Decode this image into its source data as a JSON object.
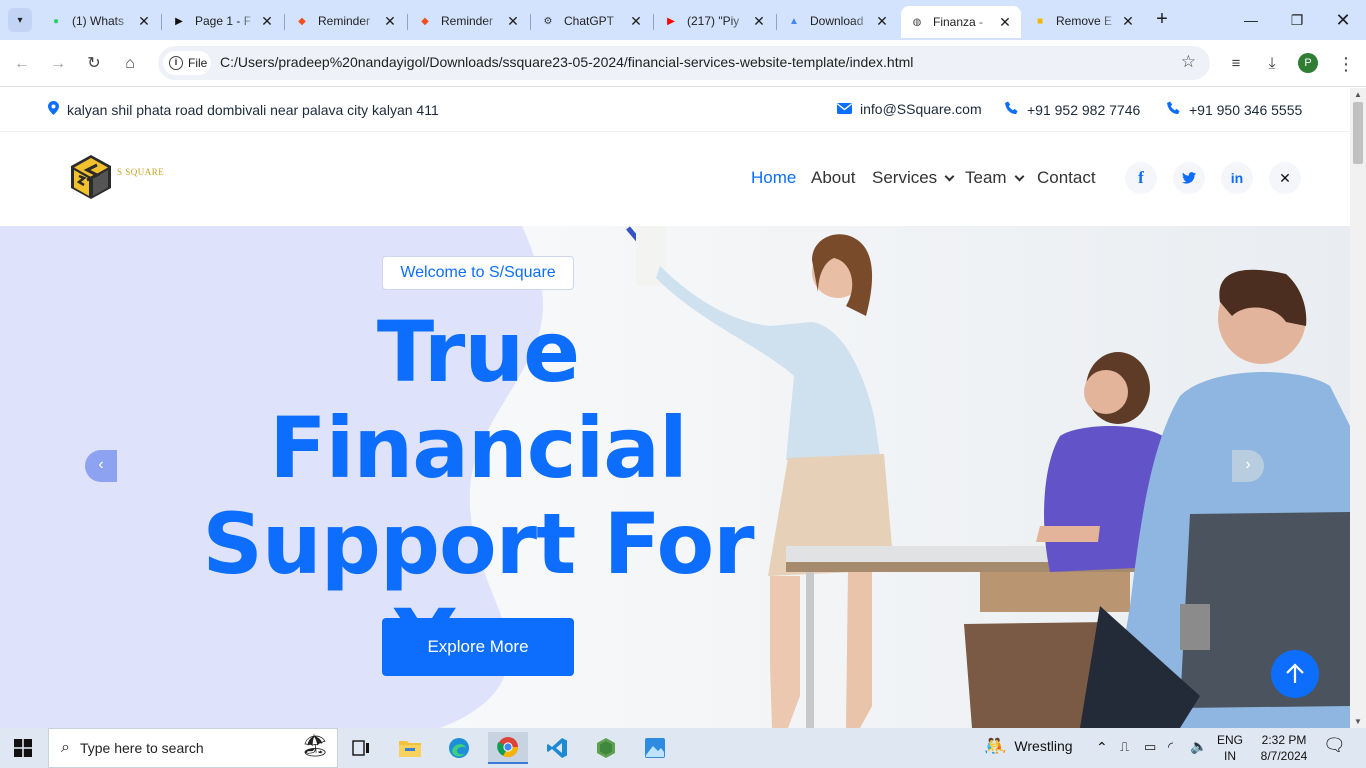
{
  "browser": {
    "tabs": [
      {
        "title": "(1) Whats",
        "icon": "whatsapp-icon",
        "color": "#25d366"
      },
      {
        "title": "Page 1 - F",
        "icon": "play-icon",
        "color": "#111111"
      },
      {
        "title": "Reminder",
        "icon": "figma-icon",
        "color": "#f24e1e"
      },
      {
        "title": "Reminder",
        "icon": "figma-icon",
        "color": "#f24e1e"
      },
      {
        "title": "ChatGPT",
        "icon": "chatgpt-icon",
        "color": "#333333"
      },
      {
        "title": "(217) \"Piy",
        "icon": "youtube-icon",
        "color": "#ff0000"
      },
      {
        "title": "Download",
        "icon": "drive-icon",
        "color": "#4285f4"
      },
      {
        "title": "Finanza -",
        "icon": "globe-icon",
        "color": "#444444"
      },
      {
        "title": "Remove E",
        "icon": "remove-bg-icon",
        "color": "#f5b400"
      }
    ],
    "active_tab": 7,
    "file_chip": "File",
    "url": "C:/Users/pradeep%20nandayigol/Downloads/ssquare23-05-2024/financial-services-website-template/index.html",
    "profile_initial": "P"
  },
  "topbar": {
    "address": "kalyan shil phata road dombivali near palava city kalyan 411",
    "email": "info@SSquare.com",
    "phone1": "+91 952 982 7746",
    "phone2": "+91 950 346 5555"
  },
  "nav": {
    "logo_text": "S SQUARE",
    "links": {
      "home": "Home",
      "about": "About",
      "services": "Services",
      "team": "Team",
      "contact": "Contact"
    },
    "social": {
      "facebook": "f",
      "twitter": "t",
      "linkedin": "in",
      "x": "✕"
    }
  },
  "hero": {
    "welcome": "Welcome to S/Square",
    "heading_line1": "True Financial",
    "heading_line2": "Support For",
    "heading_line3": "You",
    "cta": "Explore More"
  },
  "taskbar": {
    "search_placeholder": "Type here to search",
    "weather": "Wrestling",
    "lang1": "ENG",
    "lang2": "IN",
    "time": "2:32 PM",
    "date": "8/7/2024"
  },
  "colors": {
    "accent": "#0d6efd",
    "hero_blob": "#dfe2fb",
    "tab_strip": "#d3e3fd"
  }
}
